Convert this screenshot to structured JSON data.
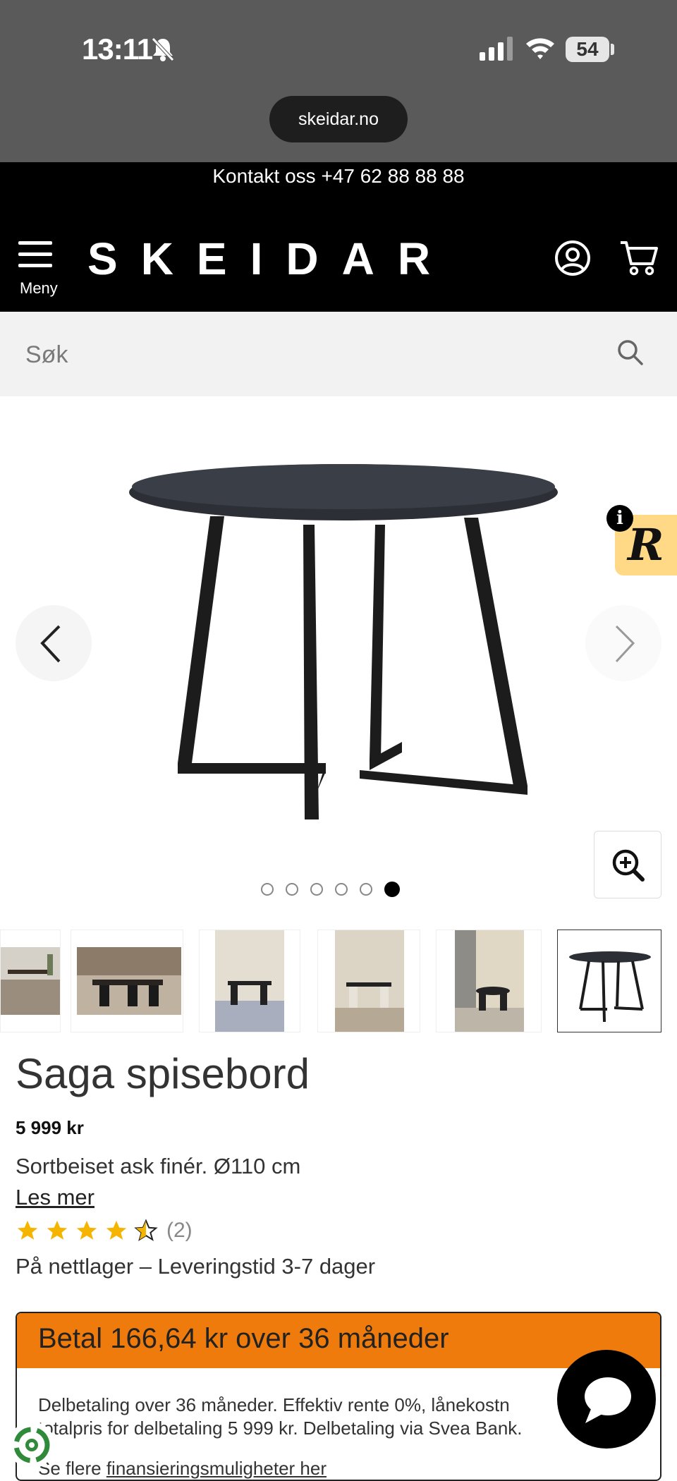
{
  "status_bar": {
    "time": "13:11",
    "battery": "54",
    "url": "skeidar.no"
  },
  "header": {
    "contact": "Kontakt oss +47 62 88 88 88",
    "menu_label": "Meny",
    "logo": "SKEIDAR"
  },
  "search": {
    "placeholder": "Søk"
  },
  "gallery": {
    "slide_count": 6,
    "active_slide": 6
  },
  "product": {
    "title": "Saga spisebord",
    "price": "5 999 kr",
    "description": "Sortbeiset ask finér. Ø110 cm",
    "read_more": "Les mer",
    "rating": 4.5,
    "review_count": "(2)",
    "stock": "På nettlager – Leveringstid 3-7 dager"
  },
  "finance": {
    "title": "Betal 166,64 kr over 36 måneder",
    "line1": "Delbetaling over 36 måneder. Effektiv rente 0%, lånekostn",
    "line2": "totalpris for delbetaling 5 999 kr. Delbetaling via Svea Bank.",
    "link_prefix": "Se flere ",
    "link_text": "finansieringsmuligheter her"
  },
  "colors": {
    "header_bg": "#000000",
    "finance_accent": "#ef7b0d",
    "star": "#f5b400",
    "badge_bg": "#ffd985"
  },
  "icons": [
    "bell-slash-icon",
    "signal-icon",
    "wifi-icon",
    "menu-icon",
    "user-icon",
    "cart-icon",
    "search-icon",
    "chevron-left-icon",
    "chevron-right-icon",
    "zoom-in-icon",
    "chat-icon",
    "recycle-icon",
    "info-icon"
  ]
}
